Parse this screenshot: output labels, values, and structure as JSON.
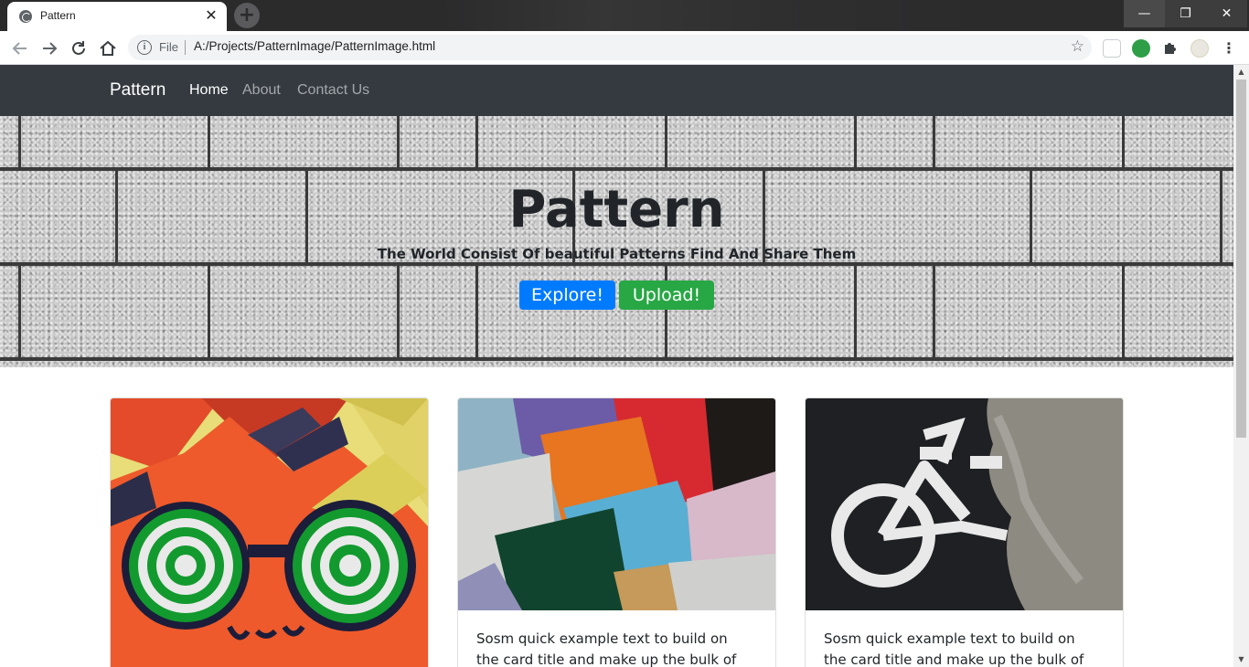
{
  "browser": {
    "tab_title": "Pattern",
    "tab_close": "✕",
    "new_tab": "+",
    "window_controls": {
      "minimize": "—",
      "maximize": "❐",
      "close": "✕"
    },
    "address": {
      "scheme_label": "File",
      "url": "A:/Projects/PatternImage/PatternImage.html"
    },
    "icons": [
      "back-icon",
      "forward-icon",
      "reload-icon",
      "home-icon",
      "info-icon",
      "star-icon",
      "extension-icon",
      "puzzle-icon",
      "menu-icon"
    ]
  },
  "navbar": {
    "brand": "Pattern",
    "links": [
      {
        "label": "Home",
        "active": true
      },
      {
        "label": "About",
        "active": false
      },
      {
        "label": "Contact Us",
        "active": false
      }
    ],
    "colors": {
      "background": "#343a40"
    }
  },
  "hero": {
    "title": "Pattern",
    "subtitle": "The World Consist Of beautiful Patterns Find And Share Them",
    "buttons": [
      {
        "label": "Explore!",
        "color": "#007bff"
      },
      {
        "label": "Upload!",
        "color": "#28a745"
      }
    ]
  },
  "cards": [
    {
      "image": "graffiti-spiral-eyes",
      "text": ""
    },
    {
      "image": "colored-paper-squares",
      "text": "Sosm quick example text to build on the card title and make up the bulk of the"
    },
    {
      "image": "bike-lane-symbol",
      "text": "Sosm quick example text to build on the card title and make up the bulk of the"
    }
  ]
}
